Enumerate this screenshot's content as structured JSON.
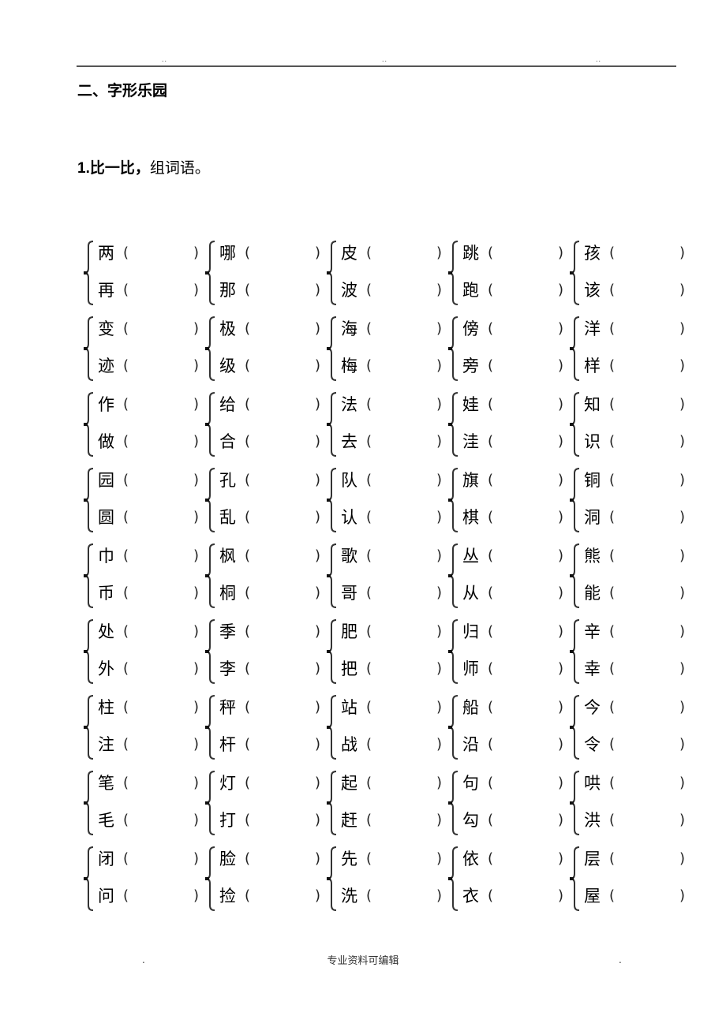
{
  "header": {
    "marks": [
      "..",
      "..",
      ".."
    ]
  },
  "section_title": "二、字形乐园",
  "task": {
    "number": "1.",
    "bold_part": "比一比，",
    "rest": "组词语。"
  },
  "paren_open": "(",
  "paren_close": ")",
  "pairs": [
    [
      {
        "top": "两",
        "bottom": "再"
      },
      {
        "top": "哪",
        "bottom": "那"
      },
      {
        "top": "皮",
        "bottom": "波"
      },
      {
        "top": "跳",
        "bottom": "跑"
      },
      {
        "top": "孩",
        "bottom": "该"
      }
    ],
    [
      {
        "top": "变",
        "bottom": "迹"
      },
      {
        "top": "极",
        "bottom": "级"
      },
      {
        "top": "海",
        "bottom": "梅"
      },
      {
        "top": "傍",
        "bottom": "旁"
      },
      {
        "top": "洋",
        "bottom": "样"
      }
    ],
    [
      {
        "top": "作",
        "bottom": "做"
      },
      {
        "top": "给",
        "bottom": "合"
      },
      {
        "top": "法",
        "bottom": "去"
      },
      {
        "top": "娃",
        "bottom": "洼"
      },
      {
        "top": "知",
        "bottom": "识"
      }
    ],
    [
      {
        "top": "园",
        "bottom": "圆"
      },
      {
        "top": "孔",
        "bottom": "乱"
      },
      {
        "top": "队",
        "bottom": "认"
      },
      {
        "top": "旗",
        "bottom": "棋"
      },
      {
        "top": "铜",
        "bottom": "洞"
      }
    ],
    [
      {
        "top": "巾",
        "bottom": "币"
      },
      {
        "top": "枫",
        "bottom": "桐"
      },
      {
        "top": "歌",
        "bottom": "哥"
      },
      {
        "top": "丛",
        "bottom": "从"
      },
      {
        "top": "熊",
        "bottom": "能"
      }
    ],
    [
      {
        "top": "处",
        "bottom": "外"
      },
      {
        "top": "季",
        "bottom": "李"
      },
      {
        "top": "肥",
        "bottom": "把"
      },
      {
        "top": "归",
        "bottom": "师"
      },
      {
        "top": "辛",
        "bottom": "幸"
      }
    ],
    [
      {
        "top": "柱",
        "bottom": "注"
      },
      {
        "top": "秤",
        "bottom": "杆"
      },
      {
        "top": "站",
        "bottom": "战"
      },
      {
        "top": "船",
        "bottom": "沿"
      },
      {
        "top": "今",
        "bottom": "令"
      }
    ],
    [
      {
        "top": "笔",
        "bottom": "毛"
      },
      {
        "top": "灯",
        "bottom": "打"
      },
      {
        "top": "起",
        "bottom": "赶"
      },
      {
        "top": "句",
        "bottom": "勾"
      },
      {
        "top": "哄",
        "bottom": "洪"
      }
    ],
    [
      {
        "top": "闭",
        "bottom": "问"
      },
      {
        "top": "脸",
        "bottom": "捡"
      },
      {
        "top": "先",
        "bottom": "洗"
      },
      {
        "top": "依",
        "bottom": "衣"
      },
      {
        "top": "层",
        "bottom": "屋"
      }
    ]
  ],
  "footer": {
    "text": "专业资料可编辑",
    "left_mark": ".",
    "right_mark": "."
  }
}
